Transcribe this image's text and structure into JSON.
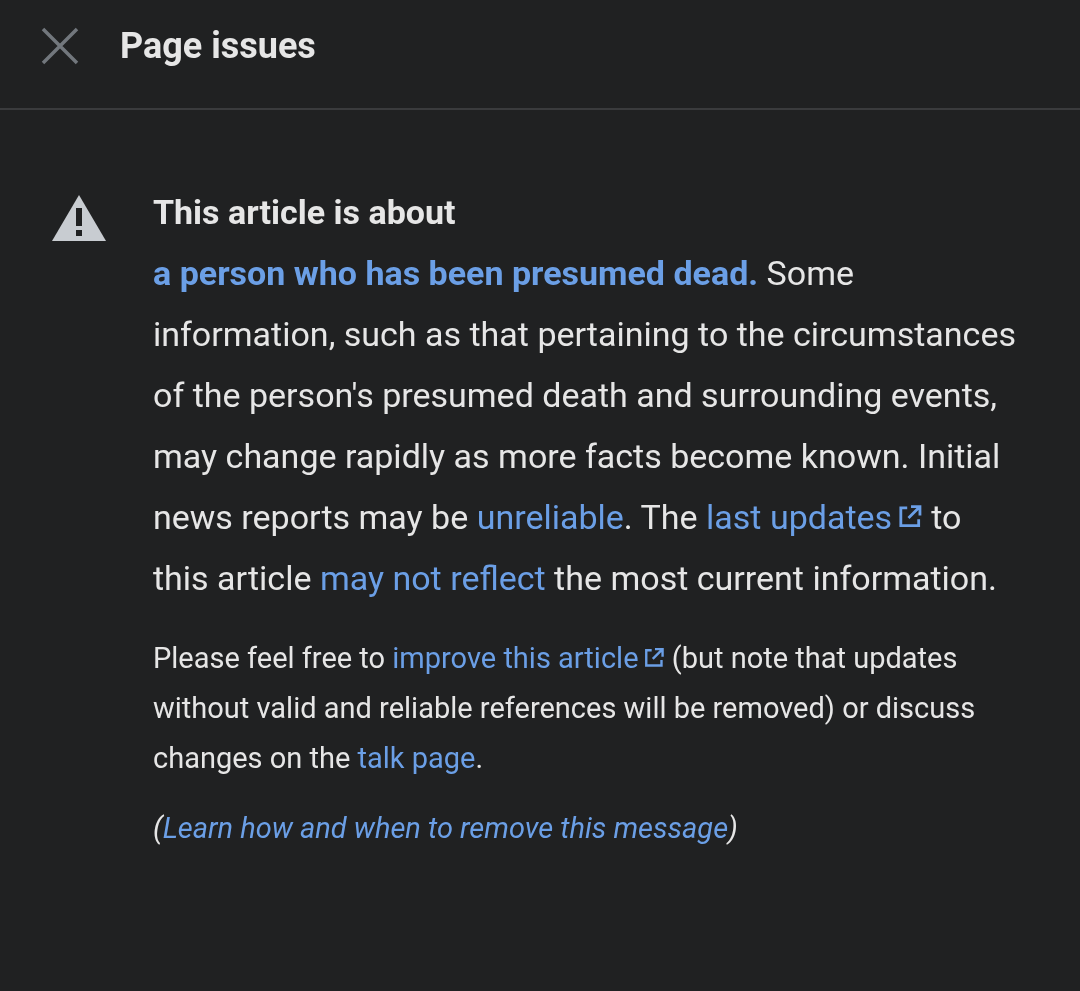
{
  "header": {
    "title": "Page issues"
  },
  "notice": {
    "paragraphs": [
      {
        "kind": "main",
        "segments": [
          {
            "kind": "bold",
            "text": "This article is about "
          },
          {
            "kind": "link",
            "bold": true,
            "external": false,
            "text": "a person who has been presumed dead."
          },
          {
            "kind": "text",
            "text": " Some information, such as that pertaining to the circumstances of the person's presumed death and surrounding events, may change rapidly as more facts become known. Initial news reports may be "
          },
          {
            "kind": "link",
            "bold": false,
            "external": false,
            "text": "unreliable"
          },
          {
            "kind": "text",
            "text": ". The "
          },
          {
            "kind": "link",
            "bold": false,
            "external": true,
            "text": "last updates"
          },
          {
            "kind": "text",
            "text": " to this article "
          },
          {
            "kind": "link",
            "bold": false,
            "external": false,
            "text": "may not reflect"
          },
          {
            "kind": "text",
            "text": " the most current information."
          }
        ]
      },
      {
        "kind": "small",
        "segments": [
          {
            "kind": "text",
            "text": "Please feel free to "
          },
          {
            "kind": "link",
            "bold": false,
            "external": true,
            "text": "improve this article"
          },
          {
            "kind": "text",
            "text": " (but note that updates without valid and reliable references will be removed) or discuss changes on the "
          },
          {
            "kind": "link",
            "bold": false,
            "external": false,
            "text": "talk page"
          },
          {
            "kind": "text",
            "text": "."
          }
        ]
      },
      {
        "kind": "note",
        "segments": [
          {
            "kind": "text",
            "text": "("
          },
          {
            "kind": "link",
            "bold": false,
            "external": false,
            "text": "Learn how and when to remove this message"
          },
          {
            "kind": "text",
            "text": ")"
          }
        ]
      }
    ]
  }
}
